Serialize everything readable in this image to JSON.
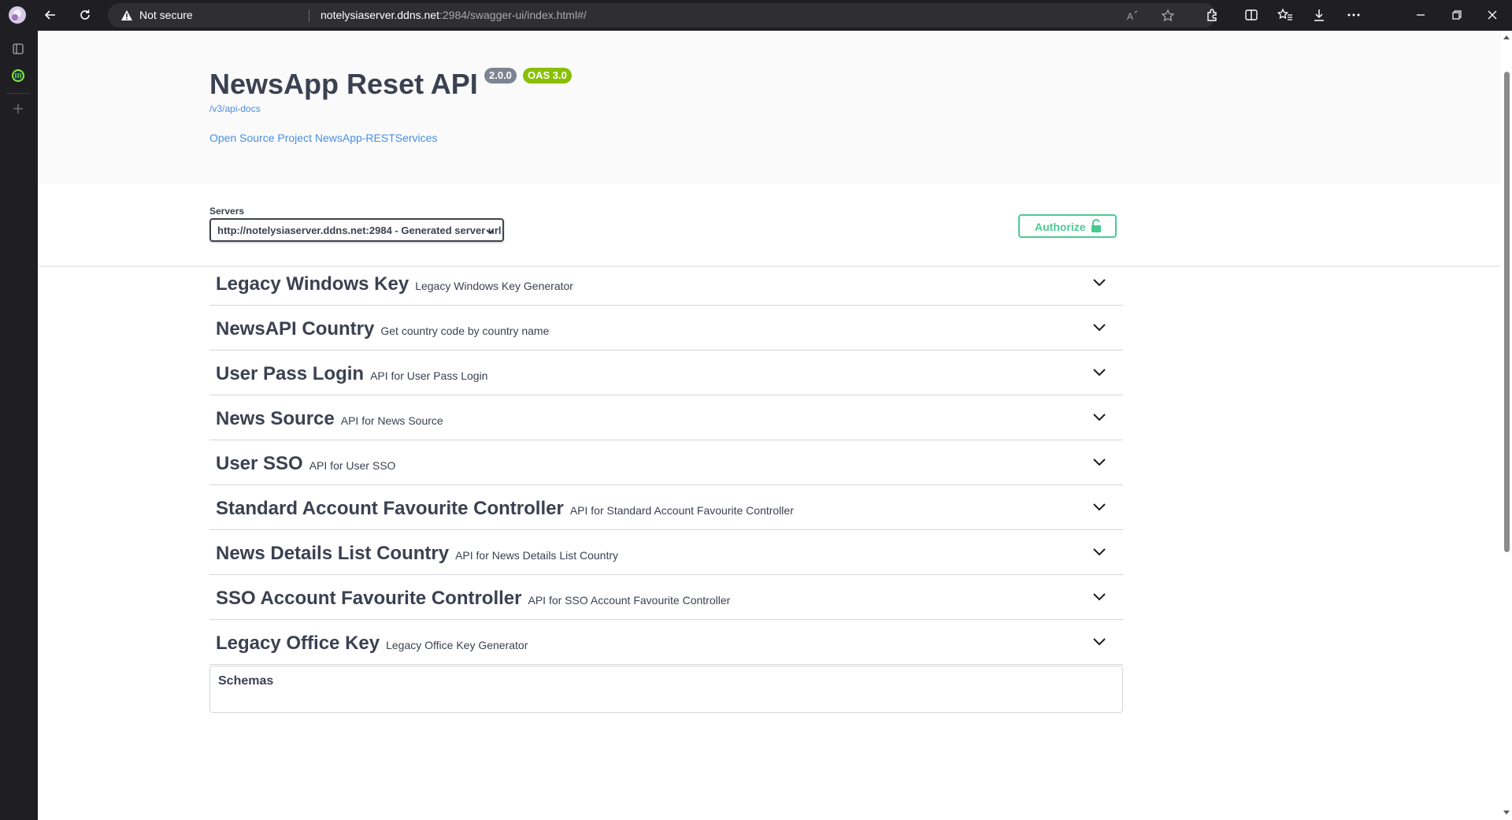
{
  "browser": {
    "security_label": "Not secure",
    "url_host": "notelysiaserver.ddns.net",
    "url_rest": ":2984/swagger-ui/index.html#/"
  },
  "info": {
    "title": "NewsApp Reset API",
    "version_badge": "2.0.0",
    "oas_badge": "OAS 3.0",
    "api_docs_link": "/v3/api-docs",
    "project_link": "Open Source Project NewsApp-RESTServices"
  },
  "servers": {
    "label": "Servers",
    "selected": "http://notelysiaserver.ddns.net:2984 - Generated server url"
  },
  "authorize_label": "Authorize",
  "tags": [
    {
      "name": "Legacy Windows Key",
      "description": "Legacy Windows Key Generator"
    },
    {
      "name": "NewsAPI Country",
      "description": "Get country code by country name"
    },
    {
      "name": "User Pass Login",
      "description": "API for User Pass Login"
    },
    {
      "name": "News Source",
      "description": "API for News Source"
    },
    {
      "name": "User SSO",
      "description": "API for User SSO"
    },
    {
      "name": "Standard Account Favourite Controller",
      "description": "API for Standard Account Favourite Controller"
    },
    {
      "name": "News Details List Country",
      "description": "API for News Details List Country"
    },
    {
      "name": "SSO Account Favourite Controller",
      "description": "API for SSO Account Favourite Controller"
    },
    {
      "name": "Legacy Office Key",
      "description": "Legacy Office Key Generator"
    }
  ],
  "schemas_label": "Schemas",
  "colors": {
    "accent_green": "#49cc90",
    "link_blue": "#4990e2",
    "oas_green": "#89bf04",
    "text_dark": "#3b4151"
  }
}
